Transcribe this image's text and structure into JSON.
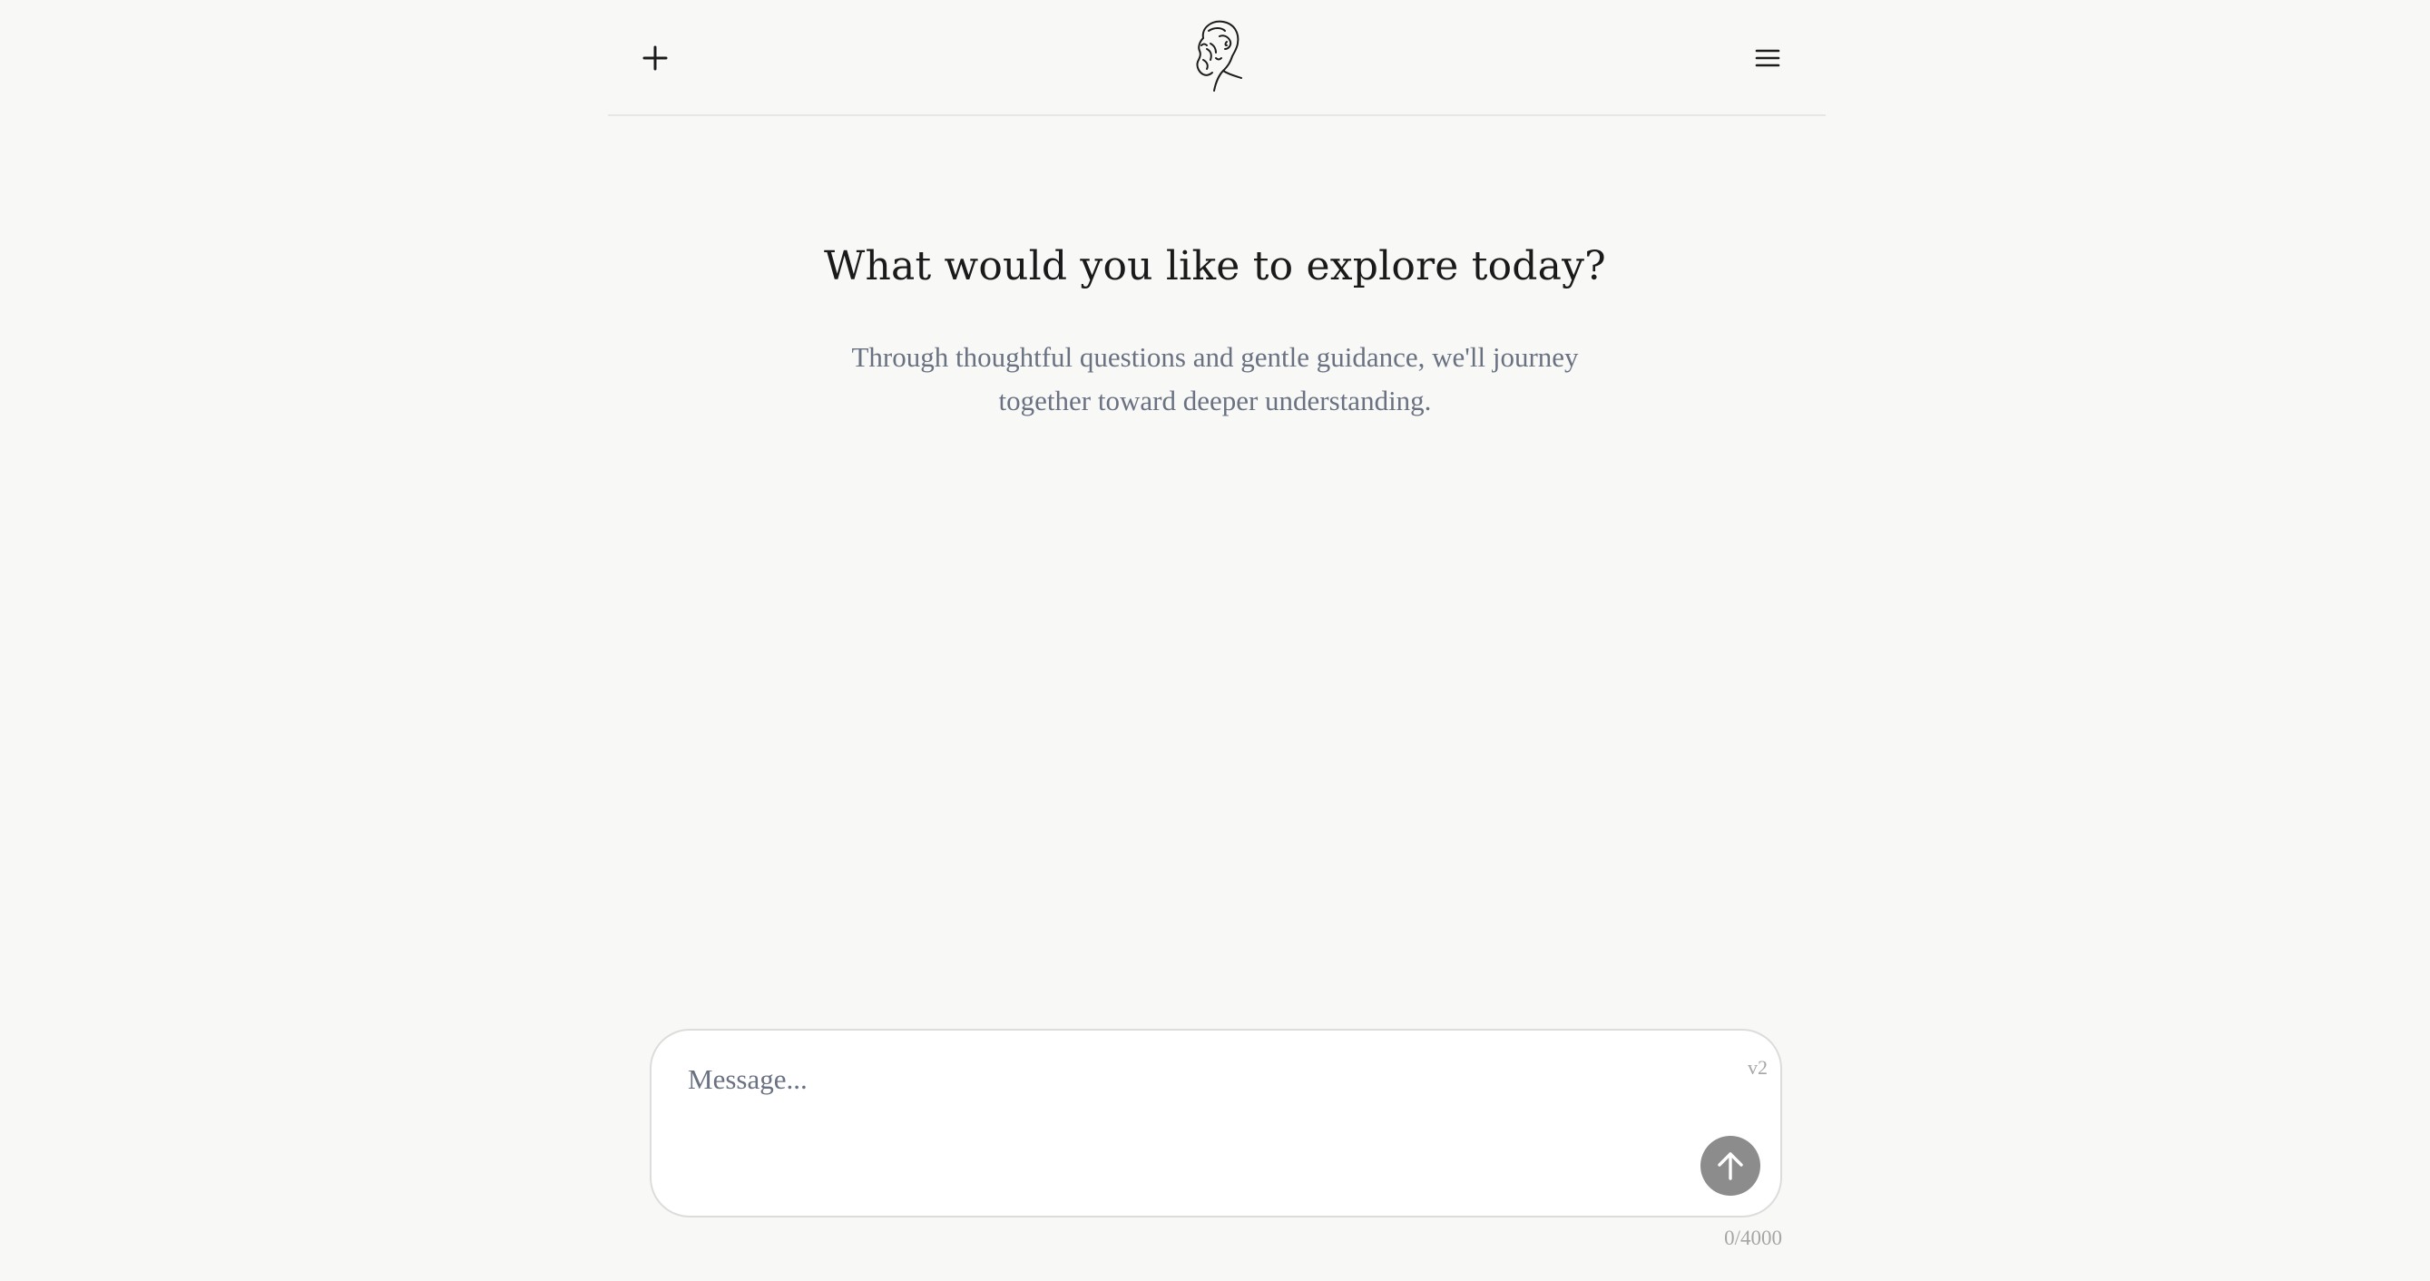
{
  "header": {
    "new_icon": "plus-icon",
    "logo_icon": "philosopher-head-icon",
    "menu_icon": "hamburger-menu-icon"
  },
  "hero": {
    "title": "What would you like to explore today?",
    "subtitle": "Through thoughtful questions and gentle guidance, we'll journey together toward deeper understanding."
  },
  "composer": {
    "placeholder": "Message...",
    "value": "",
    "version": "v2",
    "send_icon": "arrow-up-icon",
    "char_count": "0/4000"
  },
  "colors": {
    "background": "#f8f8f7",
    "text": "#1a1a1a",
    "muted": "#6a7282",
    "send_button": "#8c8c8c"
  }
}
